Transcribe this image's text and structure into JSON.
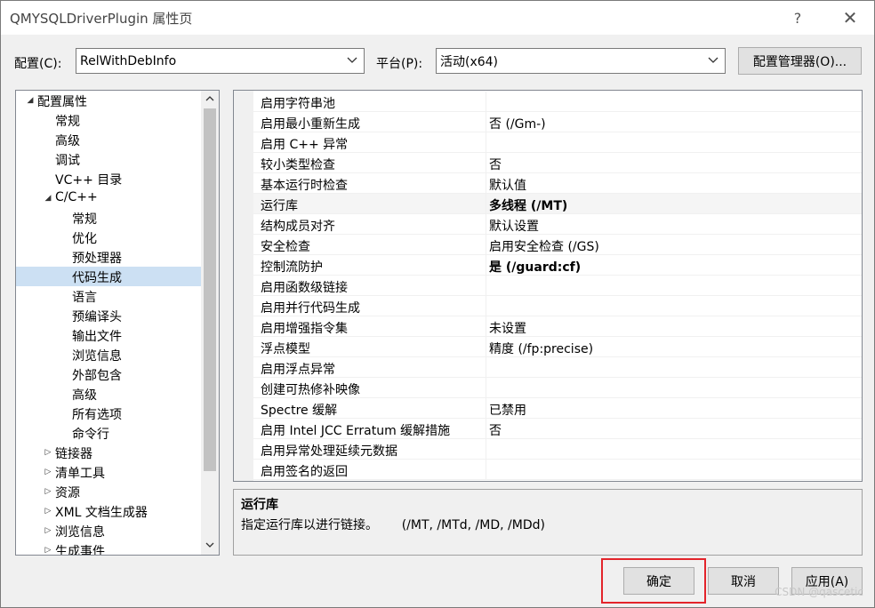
{
  "window": {
    "title": "QMYSQLDriverPlugin 属性页",
    "help_glyph": "?",
    "close_glyph": "✕"
  },
  "config": {
    "config_label": "配置(C):",
    "config_value": "RelWithDebInfo",
    "platform_label": "平台(P):",
    "platform_value": "活动(x64)",
    "manager_button": "配置管理器(O)..."
  },
  "tree": {
    "items": [
      {
        "label": "配置属性",
        "toggle": "◢"
      },
      {
        "label": "常规"
      },
      {
        "label": "高级"
      },
      {
        "label": "调试"
      },
      {
        "label": "VC++ 目录"
      },
      {
        "label": "C/C++",
        "toggle": "◢"
      },
      {
        "label": "常规"
      },
      {
        "label": "优化"
      },
      {
        "label": "预处理器"
      },
      {
        "label": "代码生成",
        "selected": true
      },
      {
        "label": "语言"
      },
      {
        "label": "预编译头"
      },
      {
        "label": "输出文件"
      },
      {
        "label": "浏览信息"
      },
      {
        "label": "外部包含"
      },
      {
        "label": "高级"
      },
      {
        "label": "所有选项"
      },
      {
        "label": "命令行"
      },
      {
        "label": "链接器",
        "toggle": "▷"
      },
      {
        "label": "清单工具",
        "toggle": "▷"
      },
      {
        "label": "资源",
        "toggle": "▷"
      },
      {
        "label": "XML 文档生成器",
        "toggle": "▷"
      },
      {
        "label": "浏览信息",
        "toggle": "▷"
      },
      {
        "label": "生成事件",
        "toggle": "▷"
      }
    ]
  },
  "properties": [
    {
      "name": "启用字符串池",
      "value": ""
    },
    {
      "name": "启用最小重新生成",
      "value": "否 (/Gm-)"
    },
    {
      "name": "启用 C++ 异常",
      "value": ""
    },
    {
      "name": "较小类型检查",
      "value": "否"
    },
    {
      "name": "基本运行时检查",
      "value": "默认值"
    },
    {
      "name": "运行库",
      "value": "多线程 (/MT)",
      "bold": true,
      "selected": true
    },
    {
      "name": "结构成员对齐",
      "value": "默认设置"
    },
    {
      "name": "安全检查",
      "value": "启用安全检查 (/GS)"
    },
    {
      "name": "控制流防护",
      "value": "是 (/guard:cf)",
      "bold": true
    },
    {
      "name": "启用函数级链接",
      "value": ""
    },
    {
      "name": "启用并行代码生成",
      "value": ""
    },
    {
      "name": "启用增强指令集",
      "value": "未设置"
    },
    {
      "name": "浮点模型",
      "value": "精度 (/fp:precise)"
    },
    {
      "name": "启用浮点异常",
      "value": ""
    },
    {
      "name": "创建可热修补映像",
      "value": ""
    },
    {
      "name": "Spectre 缓解",
      "value": "已禁用"
    },
    {
      "name": "启用 Intel JCC Erratum 缓解措施",
      "value": "否"
    },
    {
      "name": "启用异常处理延续元数据",
      "value": ""
    },
    {
      "name": "启用签名的返回",
      "value": ""
    }
  ],
  "description": {
    "title": "运行库",
    "text": "指定运行库以进行链接。      (/MT, /MTd, /MD, /MDd)"
  },
  "buttons": {
    "ok": "确定",
    "cancel": "取消",
    "apply": "应用(A)"
  },
  "watermark": "CSDN @qascetic",
  "colors": {
    "selection": "#cce0f3",
    "highlight_box": "#e3242b"
  }
}
